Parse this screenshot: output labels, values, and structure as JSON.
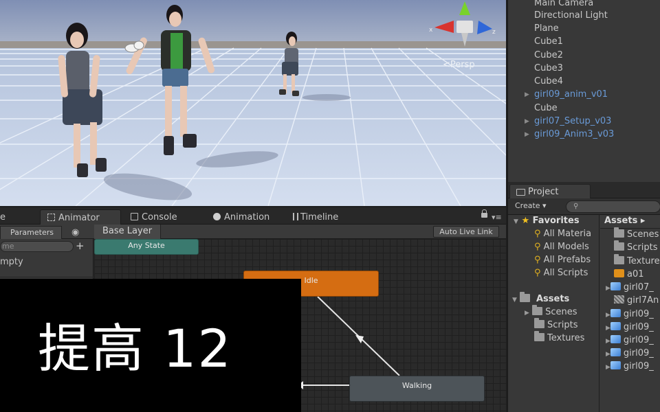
{
  "scene": {
    "persp_label": "<Persp"
  },
  "hierarchy": {
    "items": [
      {
        "label": "Main Camera",
        "prefab": false,
        "expandable": false
      },
      {
        "label": "Directional Light",
        "prefab": false,
        "expandable": false
      },
      {
        "label": "Plane",
        "prefab": false,
        "expandable": false
      },
      {
        "label": "Cube1",
        "prefab": false,
        "expandable": false
      },
      {
        "label": "Cube2",
        "prefab": false,
        "expandable": false
      },
      {
        "label": "Cube3",
        "prefab": false,
        "expandable": false
      },
      {
        "label": "Cube4",
        "prefab": false,
        "expandable": false
      },
      {
        "label": "girl09_anim_v01",
        "prefab": true,
        "expandable": true
      },
      {
        "label": "Cube",
        "prefab": false,
        "expandable": false
      },
      {
        "label": "girl07_Setup_v03",
        "prefab": true,
        "expandable": true
      },
      {
        "label": "girl09_Anim3_v03",
        "prefab": true,
        "expandable": true
      }
    ]
  },
  "project": {
    "tab_label": "Project",
    "create_label": "Create ▾",
    "favorites_label": "Favorites",
    "favorites": [
      "All Materia",
      "All Models",
      "All Prefabs",
      "All Scripts"
    ],
    "assets_label": "Assets",
    "asset_folders": [
      "Scenes",
      "Scripts",
      "Textures"
    ],
    "assets_header": "Assets ▸",
    "asset_items": [
      {
        "label": "Scenes",
        "icon": "folder"
      },
      {
        "label": "Scripts",
        "icon": "folder"
      },
      {
        "label": "Texture",
        "icon": "folder"
      },
      {
        "label": "a01",
        "icon": "anim"
      },
      {
        "label": "girl07_",
        "icon": "cube"
      },
      {
        "label": "girl7An",
        "icon": "anim"
      },
      {
        "label": "girl09_",
        "icon": "cube"
      },
      {
        "label": "girl09_",
        "icon": "cube"
      },
      {
        "label": "girl09_",
        "icon": "cube"
      },
      {
        "label": "girl09_",
        "icon": "cube"
      },
      {
        "label": "girl09_",
        "icon": "cube"
      }
    ]
  },
  "animator": {
    "tabs": {
      "left_partial": "e",
      "animator": "Animator",
      "console": "Console",
      "animation": "Animation",
      "timeline": "Timeline"
    },
    "parameters_tab": "Parameters",
    "breadcrumb": "Base Layer",
    "auto_live_link": "Auto Live Link",
    "search_placeholder": "me",
    "empty_text": "mpty",
    "plus": "+",
    "nodes": {
      "any_state": "Any State",
      "idle": "Idle",
      "walking": "Walking"
    }
  },
  "overlay": {
    "text": "提高 12"
  },
  "colors": {
    "idle_node": "#d56d12",
    "any_state_node": "#3a7a6f",
    "walking_node": "#4d5459",
    "prefab_text": "#6a9bd8"
  }
}
